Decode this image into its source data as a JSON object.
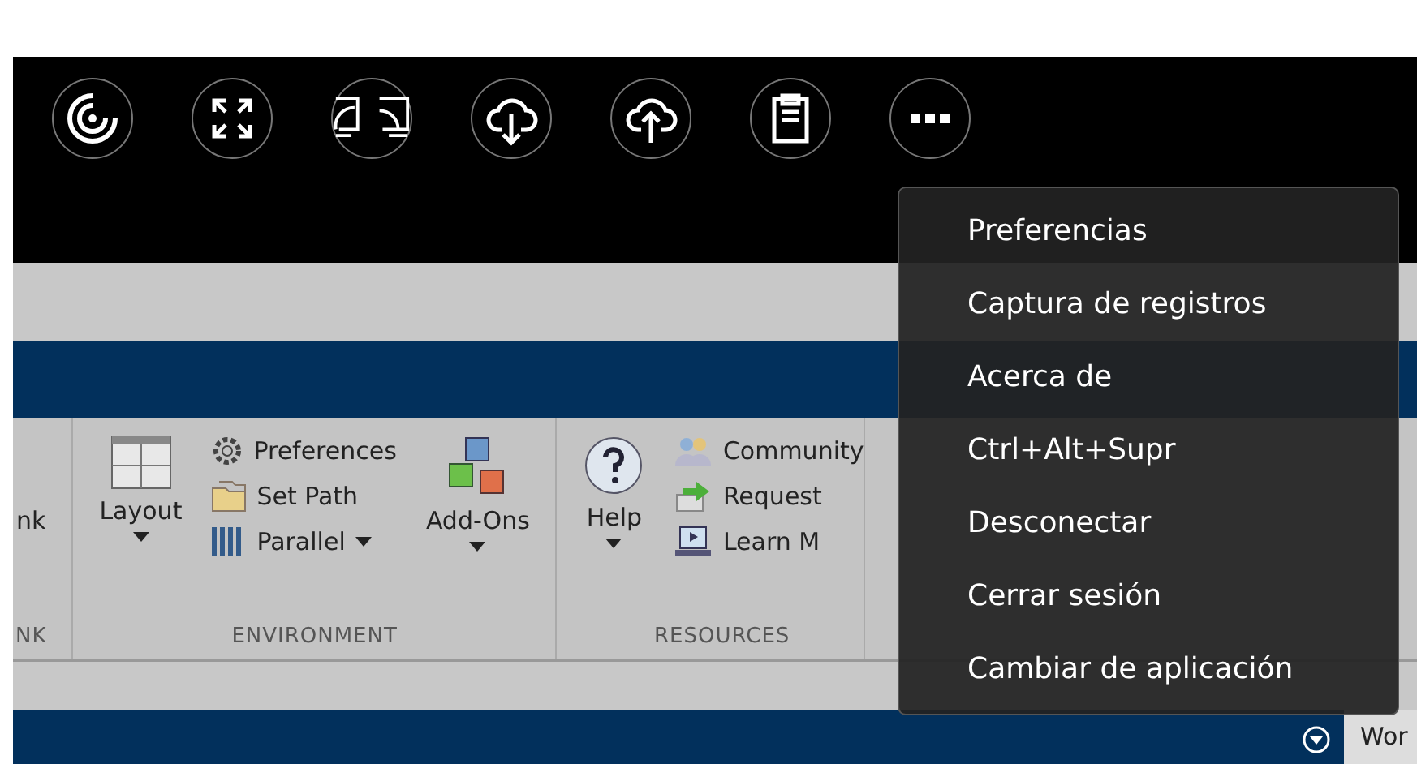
{
  "toolbar": {
    "buttons": [
      {
        "kind": "spiral"
      },
      {
        "kind": "fullscreen"
      },
      {
        "kind": "monitors"
      },
      {
        "kind": "download"
      },
      {
        "kind": "upload"
      },
      {
        "kind": "clipboard"
      },
      {
        "kind": "more"
      }
    ]
  },
  "ribbon": {
    "sections": [
      {
        "title": "NK",
        "items": [
          {
            "kind": "large",
            "label": "nk",
            "caret": false
          }
        ]
      },
      {
        "title": "ENVIRONMENT",
        "items": [
          {
            "kind": "large",
            "label": "Layout",
            "caret": true
          },
          {
            "kind": "small",
            "entries": [
              {
                "label": "Preferences",
                "caret": false
              },
              {
                "label": "Set Path",
                "caret": false
              },
              {
                "label": "Parallel",
                "caret": true
              }
            ]
          },
          {
            "kind": "large",
            "label": "Add-Ons",
            "caret": true
          }
        ]
      },
      {
        "title": "RESOURCES",
        "items": [
          {
            "kind": "large",
            "label": "Help",
            "caret": true
          },
          {
            "kind": "small",
            "entries": [
              {
                "label": "Community",
                "caret": false
              },
              {
                "label": "Request",
                "caret": false
              },
              {
                "label": "Learn M",
                "caret": false
              }
            ]
          }
        ]
      }
    ]
  },
  "bottom_bar": {
    "tab": "Wor"
  },
  "menu": {
    "items": [
      {
        "label": "Preferencias"
      },
      {
        "label": "Captura de registros"
      },
      {
        "label": "Acerca de"
      },
      {
        "label": "Ctrl+Alt+Supr"
      },
      {
        "label": "Desconectar"
      },
      {
        "label": "Cerrar sesión"
      },
      {
        "label": "Cambiar de aplicación"
      }
    ]
  }
}
